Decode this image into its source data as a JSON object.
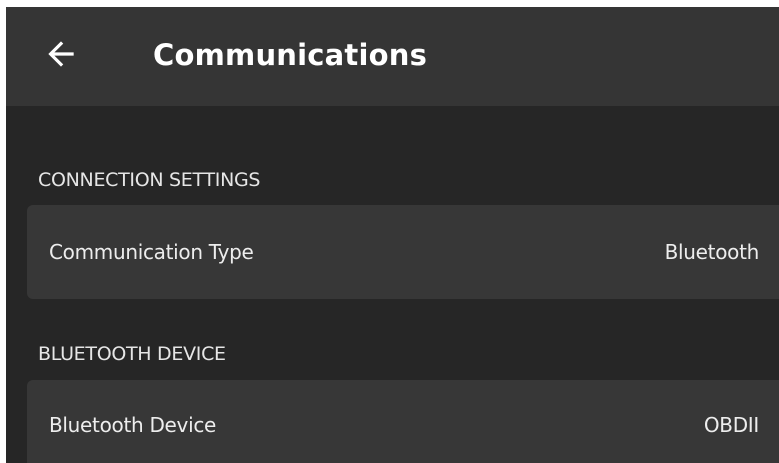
{
  "app_bar": {
    "back_icon": "arrow-left-icon",
    "title": "Communications"
  },
  "sections": [
    {
      "header": "CONNECTION SETTINGS",
      "rows": [
        {
          "label": "Communication Type",
          "value": "Bluetooth"
        }
      ]
    },
    {
      "header": "BLUETOOTH DEVICE",
      "rows": [
        {
          "label": "Bluetooth Device",
          "value": "OBDII"
        }
      ]
    }
  ],
  "colors": {
    "background": "#262626",
    "app_bar": "#353535",
    "card": "#373737",
    "text": "#ededed"
  }
}
